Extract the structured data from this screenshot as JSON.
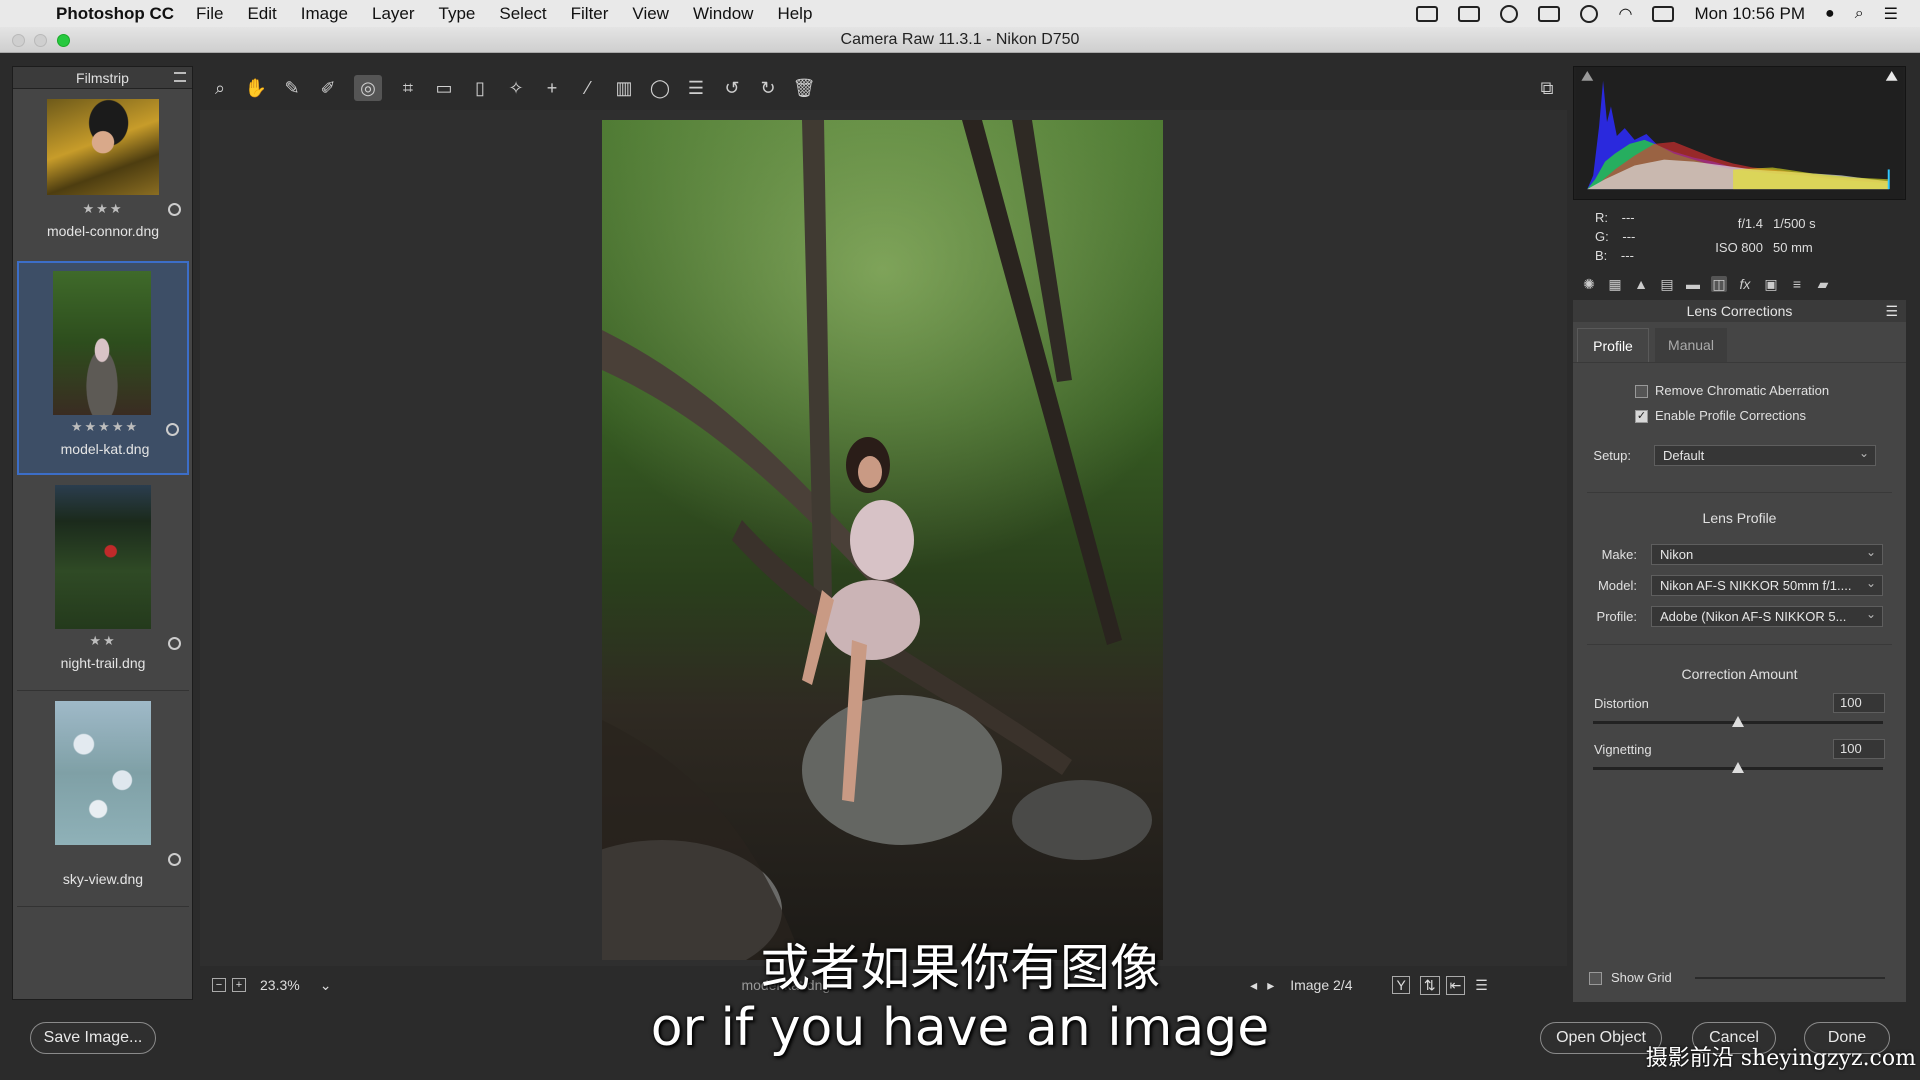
{
  "menubar": {
    "app_name": "Photoshop CC",
    "menus": [
      "File",
      "Edit",
      "Image",
      "Layer",
      "Type",
      "Select",
      "Filter",
      "View",
      "Window",
      "Help"
    ],
    "clock": "Mon 10:56 PM"
  },
  "window": {
    "title": "Camera Raw 11.3.1  -  Nikon D750"
  },
  "filmstrip": {
    "title": "Filmstrip",
    "items": [
      {
        "name": "model-connor.dng",
        "stars": "★★★",
        "selected": false
      },
      {
        "name": "model-kat.dng",
        "stars": "★★★★★",
        "selected": true
      },
      {
        "name": "night-trail.dng",
        "stars": "★★",
        "selected": false
      },
      {
        "name": "sky-view.dng",
        "stars": "",
        "selected": false
      }
    ]
  },
  "toolbar": {
    "tools": [
      "zoom-icon",
      "hand-icon",
      "white-balance-icon",
      "color-sampler-icon",
      "targeted-adjustment-icon",
      "crop-icon",
      "straighten-icon",
      "transform-icon",
      "spot-removal-icon",
      "red-eye-icon",
      "adjustment-brush-icon",
      "graduated-filter-icon",
      "radial-filter-icon",
      "preferences-icon",
      "rotate-left-icon",
      "rotate-right-icon",
      "trash-icon"
    ]
  },
  "status": {
    "zoom": "23.3%",
    "filename": "model-kat.dng",
    "image_counter": "Image 2/4"
  },
  "readout": {
    "r_label": "R:",
    "r_value": "---",
    "g_label": "G:",
    "g_value": "---",
    "b_label": "B:",
    "b_value": "---",
    "aperture": "f/1.4",
    "shutter": "1/500 s",
    "iso": "ISO 800",
    "focal": "50 mm"
  },
  "panel": {
    "title": "Lens Corrections",
    "tabs": [
      "Profile",
      "Manual"
    ],
    "remove_ca": {
      "label": "Remove Chromatic Aberration",
      "checked": false
    },
    "enable_profile": {
      "label": "Enable Profile Corrections",
      "checked": true
    },
    "setup": {
      "label": "Setup:",
      "value": "Default"
    },
    "lens_profile_title": "Lens Profile",
    "make": {
      "label": "Make:",
      "value": "Nikon"
    },
    "model": {
      "label": "Model:",
      "value": "Nikon AF-S NIKKOR 50mm f/1...."
    },
    "profile": {
      "label": "Profile:",
      "value": "Adobe (Nikon AF-S NIKKOR 5..."
    },
    "correction_title": "Correction Amount",
    "distortion": {
      "label": "Distortion",
      "value": 100
    },
    "vignetting": {
      "label": "Vignetting",
      "value": 100
    },
    "show_grid": {
      "label": "Show Grid",
      "checked": false
    }
  },
  "buttons": {
    "save": "Save Image...",
    "open": "Open Object",
    "cancel": "Cancel",
    "done": "Done"
  },
  "subtitles": {
    "chinese": "或者如果你有图像",
    "english": "or if you have an image"
  },
  "watermark": "摄影前沿 sheyingzyz.com"
}
